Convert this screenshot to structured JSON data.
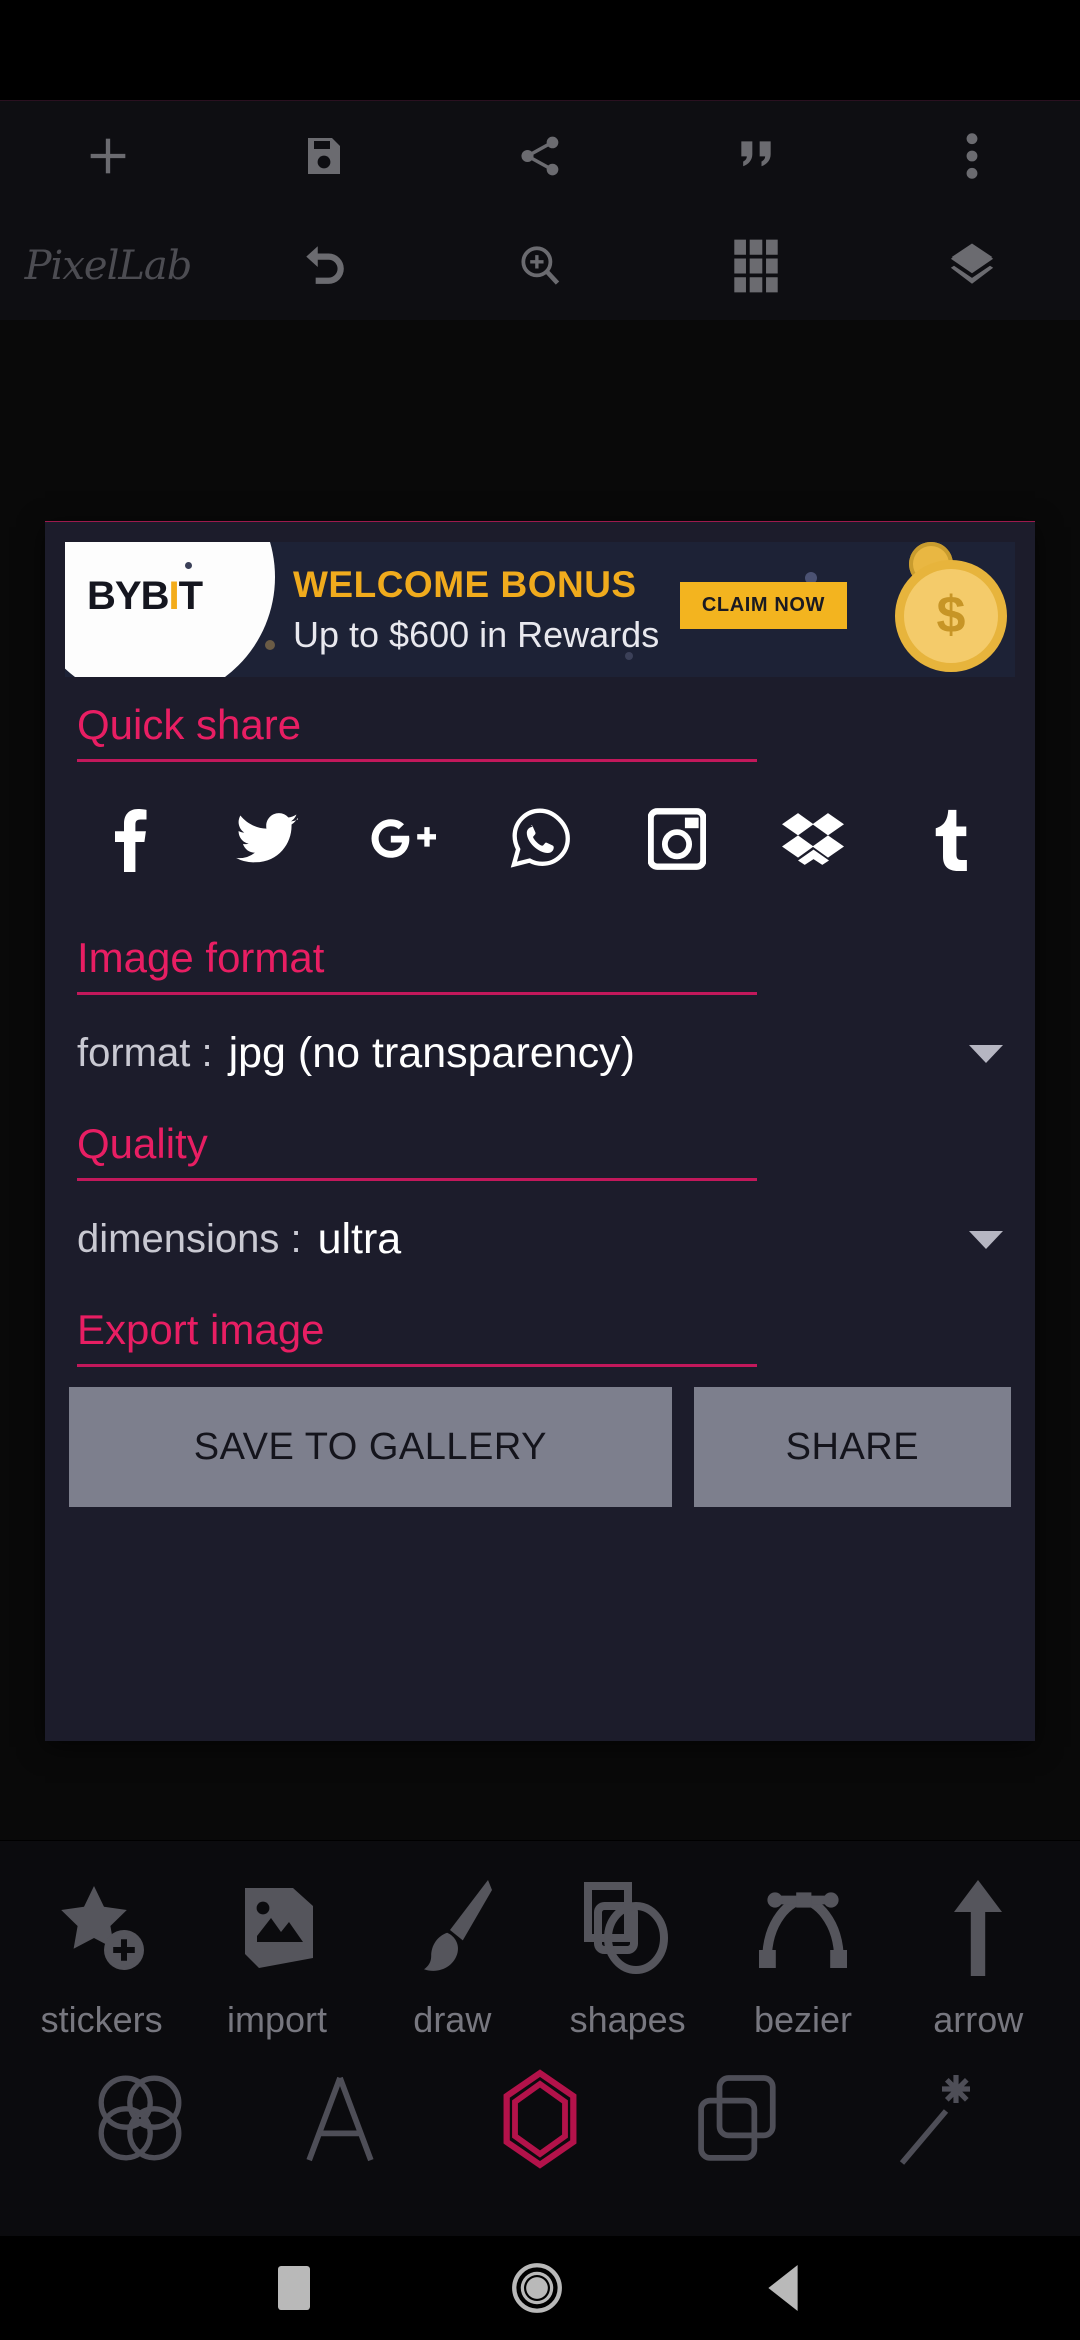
{
  "app": {
    "name": "PixelLab"
  },
  "toolbar": {
    "row1": [
      {
        "name": "add-icon",
        "label": "add"
      },
      {
        "name": "save-icon",
        "label": "save"
      },
      {
        "name": "share-icon",
        "label": "share"
      },
      {
        "name": "quote-icon",
        "label": "quote"
      },
      {
        "name": "overflow-menu-icon",
        "label": "more options"
      }
    ],
    "row2": [
      {
        "name": "app-logo",
        "label": "PixelLab"
      },
      {
        "name": "undo-icon",
        "label": "undo"
      },
      {
        "name": "zoom-in-icon",
        "label": "zoom"
      },
      {
        "name": "grid-icon",
        "label": "grid"
      },
      {
        "name": "layers-icon",
        "label": "layers"
      }
    ]
  },
  "ad": {
    "brand_prefix": "BYB",
    "brand_accent": "I",
    "brand_suffix": "T",
    "title": "WELCOME BONUS",
    "subtitle": "Up to $600 in Rewards",
    "cta": "CLAIM NOW"
  },
  "dialog": {
    "quick_share": {
      "title": "Quick share",
      "targets": [
        {
          "name": "facebook-icon",
          "label": "Facebook"
        },
        {
          "name": "twitter-icon",
          "label": "Twitter"
        },
        {
          "name": "google-plus-icon",
          "label": "Google+"
        },
        {
          "name": "whatsapp-icon",
          "label": "WhatsApp"
        },
        {
          "name": "instagram-icon",
          "label": "Instagram"
        },
        {
          "name": "dropbox-icon",
          "label": "Dropbox"
        },
        {
          "name": "tumblr-icon",
          "label": "Tumblr"
        }
      ]
    },
    "image_format": {
      "title": "Image format",
      "label": "format :",
      "value": "jpg (no transparency)"
    },
    "quality": {
      "title": "Quality",
      "label": "dimensions :",
      "value": "ultra"
    },
    "export": {
      "title": "Export image",
      "save_label": "SAVE TO GALLERY",
      "share_label": "SHARE"
    }
  },
  "tools": {
    "row1": [
      {
        "name": "stickers-icon",
        "label": "stickers"
      },
      {
        "name": "import-icon",
        "label": "import"
      },
      {
        "name": "draw-icon",
        "label": "draw"
      },
      {
        "name": "shapes-icon",
        "label": "shapes"
      },
      {
        "name": "bezier-icon",
        "label": "bezier"
      },
      {
        "name": "arrow-icon",
        "label": "arrow"
      }
    ],
    "row2": [
      {
        "name": "blend-circles-icon",
        "label": "blend"
      },
      {
        "name": "text-icon",
        "label": "text"
      },
      {
        "name": "shape-hexagon-icon",
        "label": "shape"
      },
      {
        "name": "duplicate-icon",
        "label": "duplicate"
      },
      {
        "name": "magic-wand-icon",
        "label": "effects"
      }
    ]
  },
  "navbar": [
    {
      "name": "recents-button",
      "label": "Recents"
    },
    {
      "name": "home-button",
      "label": "Home"
    },
    {
      "name": "back-button",
      "label": "Back"
    }
  ],
  "colors": {
    "accent_pink": "#e81e63",
    "rule_pink": "#c2185b",
    "dialog_bg": "#1c1c2b",
    "button_gray": "#7d7f8d",
    "ad_gold": "#f3b41f"
  }
}
